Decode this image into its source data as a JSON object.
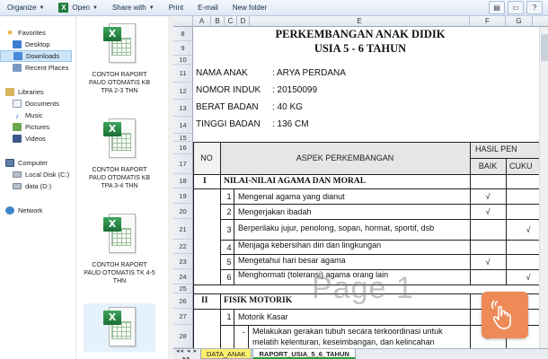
{
  "toolbar": {
    "organize": "Organize",
    "open": "Open",
    "share": "Share with",
    "print": "Print",
    "email": "E-mail",
    "new_folder": "New folder",
    "help": "?"
  },
  "nav": {
    "favorites": "Favorites",
    "desktop": "Desktop",
    "downloads": "Downloads",
    "recent": "Recent Places",
    "libraries": "Libraries",
    "documents": "Documents",
    "music": "Music",
    "pictures": "Pictures",
    "videos": "Videos",
    "computer": "Computer",
    "local_disk": "Local Disk (C:)",
    "data_disk": "data (D:)",
    "network": "Network"
  },
  "files": [
    {
      "name": "CONTOH RAPORT PAUD OTOMATIS KB TPA 2-3 THN"
    },
    {
      "name": "CONTOH RAPORT PAUD OTOMATIS KB TPA 3-4 THN"
    },
    {
      "name": "CONTOH RAPORT PAUD OTOMATIS TK 4-5 THN"
    },
    {
      "name": ""
    }
  ],
  "sheet": {
    "columns": [
      "A",
      "B",
      "C",
      "D",
      "E",
      "F",
      "G"
    ],
    "rows": [
      "8",
      "9",
      "10",
      "11",
      "12",
      "13",
      "14",
      "15",
      "16",
      "17",
      "18",
      "19",
      "20",
      "21",
      "22",
      "23",
      "24",
      "25",
      "26",
      "27",
      "28"
    ],
    "title_line1": "PERKEMBANGAN ANAK DIDIK",
    "title_line2": "USIA 5 - 6 TAHUN",
    "info": [
      {
        "label": "NAMA ANAK",
        "value": ": ARYA PERDANA"
      },
      {
        "label": "NOMOR INDUK",
        "value": ": 20150099"
      },
      {
        "label": "BERAT BADAN",
        "value": ": 40 KG"
      },
      {
        "label": "TINGGI BADAN",
        "value": ": 136 CM"
      }
    ],
    "header": {
      "no": "NO",
      "aspect": "ASPEK PERKEMBANGAN",
      "result": "HASIL PEN",
      "good": "BAIK",
      "enough": "CUKU"
    },
    "section1": {
      "num": "I",
      "title": "NILAI-NILAI AGAMA DAN MORAL"
    },
    "items1": [
      {
        "n": "1",
        "text": "Mengenal agama yang dianut",
        "baik": "√",
        "cukup": ""
      },
      {
        "n": "2",
        "text": "Mengerjakan ibadah",
        "baik": "√",
        "cukup": ""
      },
      {
        "n": "3",
        "text": "Berperilaku jujur, penolong, sopan, hormat, sportif, dsb",
        "baik": "",
        "cukup": "√"
      },
      {
        "n": "4",
        "text": "Menjaga kebersihan diri dan lingkungan",
        "baik": "",
        "cukup": ""
      },
      {
        "n": "5",
        "text": "Mengetahui hari besar agama",
        "baik": "√",
        "cukup": ""
      },
      {
        "n": "6",
        "text": "Menghormati (toleransi) agama orang lain",
        "baik": "",
        "cukup": "√"
      }
    ],
    "section2": {
      "num": "II",
      "title": "FISIK MOTORIK"
    },
    "sub1": {
      "n": "1",
      "text": "Motorik Kasar"
    },
    "sub_item": {
      "dash": "-",
      "line1": "Melakukan gerakan tubuh secara terkoordinasi untuk",
      "line2": "melatih kelenturan, keseimbangan, dan kelincahan",
      "baik": "√"
    },
    "watermark": "Page 1",
    "tabs": [
      "DATA_ANAK",
      "RAPORT_USIA_5_6_TAHUN"
    ],
    "tab_nav": "◂◂ ◂ ▸ ▸▸"
  }
}
